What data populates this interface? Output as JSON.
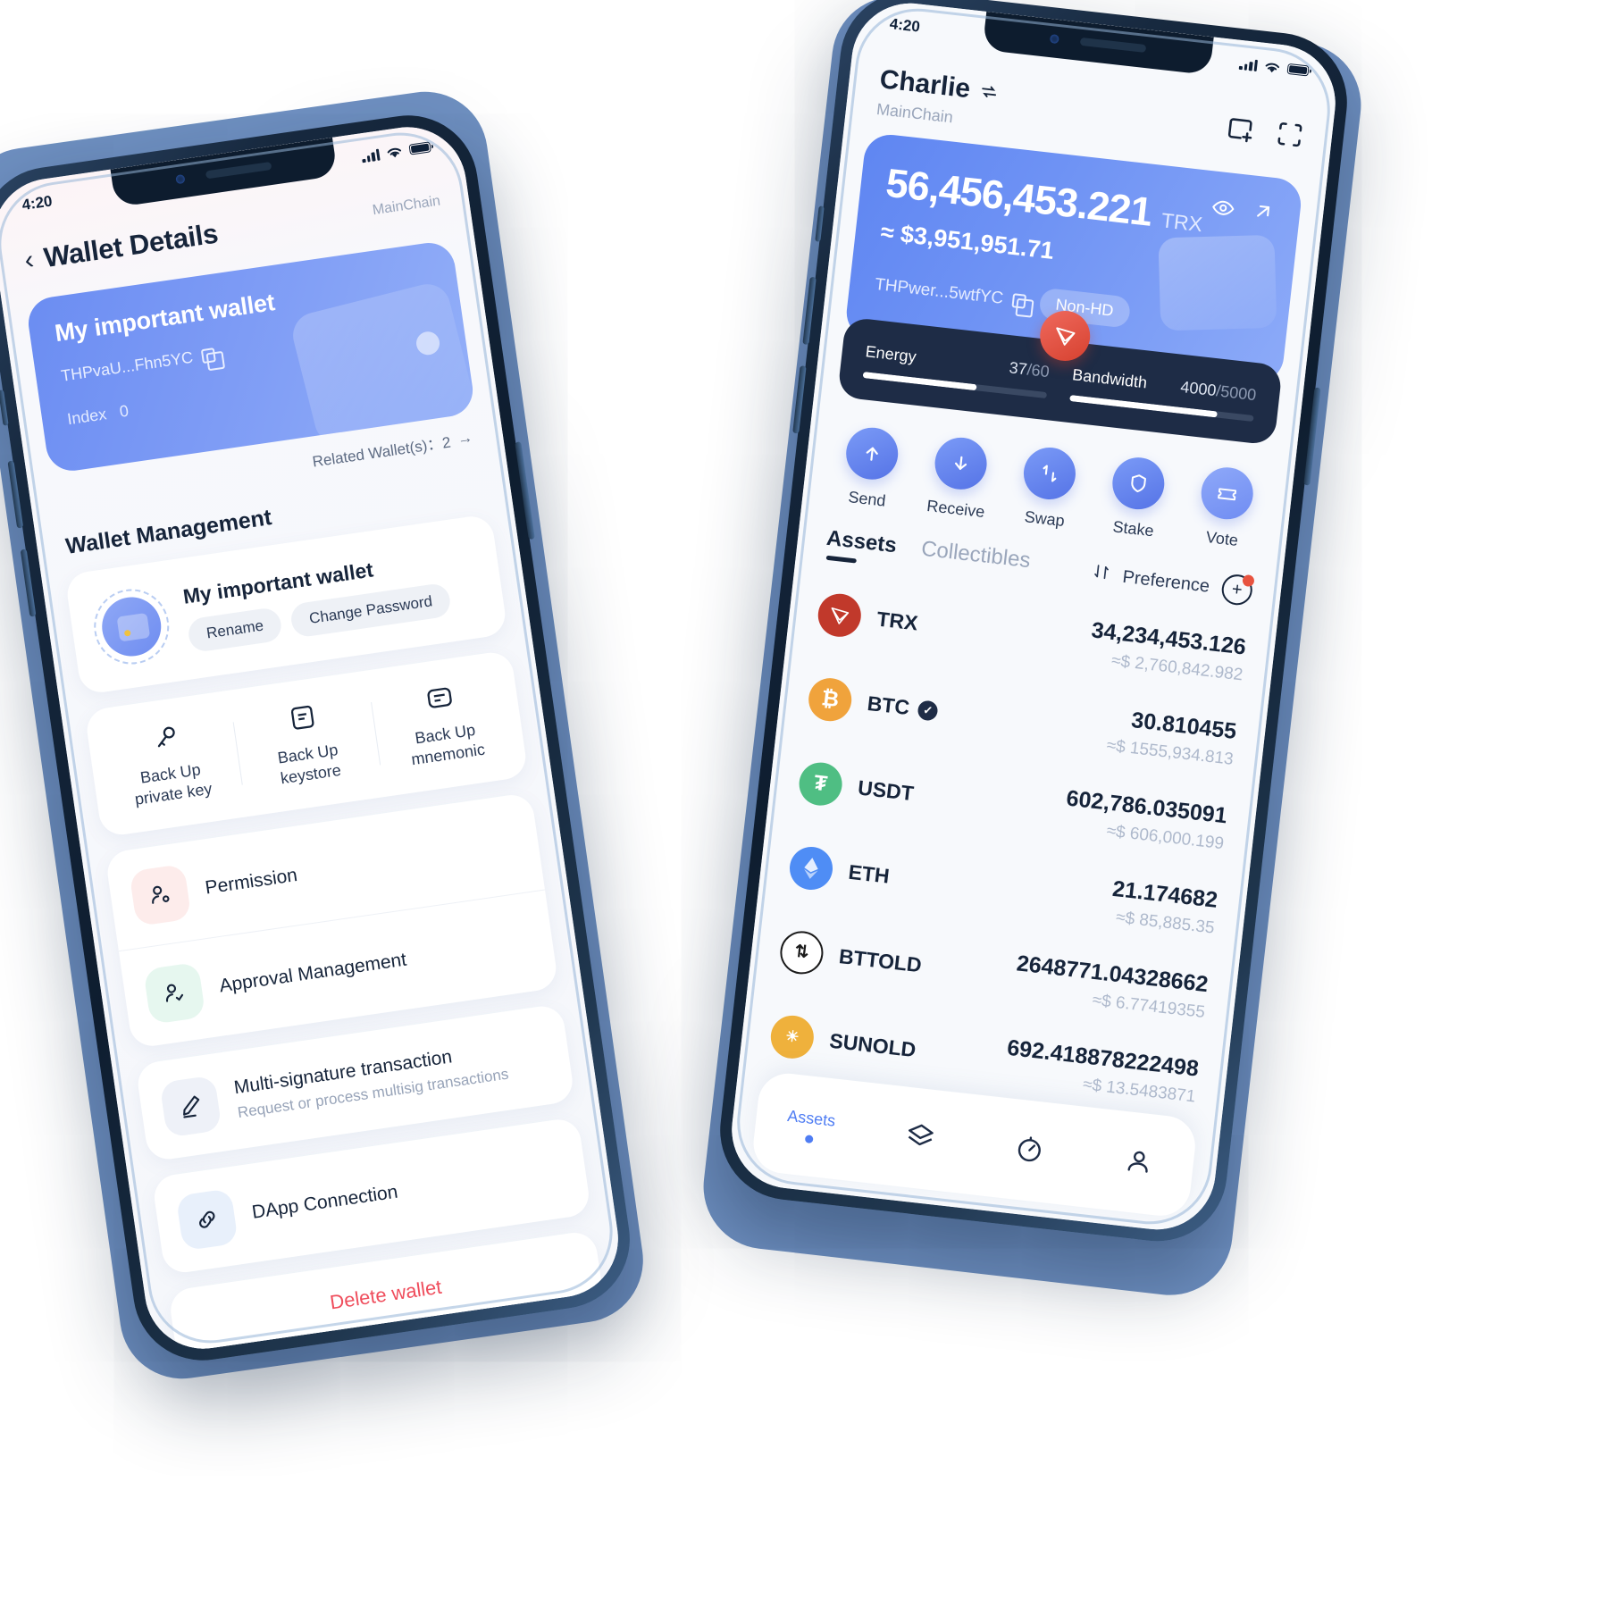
{
  "left_phone": {
    "status": {
      "time": "4:20"
    },
    "nav": {
      "back_icon": "chevron-left-icon",
      "title": "Wallet Details",
      "chain": "MainChain"
    },
    "wallet_card": {
      "name": "My important wallet",
      "address": "THPvaU...Fhn5YC",
      "copy_icon": "copy-icon",
      "index_label": "Index",
      "index_value": "0"
    },
    "related": {
      "label": "Related Wallet(s)：2",
      "arrow": "→"
    },
    "section_title": "Wallet Management",
    "wallet_row": {
      "name": "My important wallet",
      "buttons": [
        "Rename",
        "Change Password"
      ]
    },
    "backups": [
      {
        "icon": "key-icon",
        "label": "Back Up\nprivate key"
      },
      {
        "icon": "keystore-file-icon",
        "label": "Back Up\nkeystore"
      },
      {
        "icon": "mnemonic-list-icon",
        "label": "Back Up\nmnemonic"
      }
    ],
    "menu": [
      {
        "icon": "permission-user-icon",
        "label": "Permission",
        "sub": ""
      },
      {
        "icon": "approval-user-check-icon",
        "label": "Approval Management",
        "sub": ""
      },
      {
        "icon": "pencil-icon",
        "label": "Multi-signature transaction",
        "sub": "Request or process multisig transactions"
      },
      {
        "icon": "link-icon",
        "label": "DApp Connection",
        "sub": ""
      }
    ],
    "delete": {
      "label": "Delete wallet",
      "color": "#ef4d5c"
    }
  },
  "right_phone": {
    "status": {
      "time": "4:20"
    },
    "header": {
      "account_name": "Charlie",
      "switch_icon": "switch-account-icon",
      "chain": "MainChain",
      "icons": [
        "add-wallet-icon",
        "scan-qr-icon"
      ]
    },
    "balance": {
      "amount": "56,456,453.221",
      "unit": "TRX",
      "usd": "≈ $3,951,951.71",
      "address": "THPwer...5wtfYC",
      "copy_icon": "copy-icon",
      "tag": "Non-HD",
      "eye_icon": "eye-icon",
      "share_icon": "arrow-up-right-icon",
      "tron_badge_icon": "tron-logo-icon"
    },
    "resources": [
      {
        "label": "Energy",
        "value": "37",
        "max": "60",
        "percent": 62
      },
      {
        "label": "Bandwidth",
        "value": "4000",
        "max": "5000",
        "percent": 80
      }
    ],
    "actions": [
      {
        "icon": "arrow-up-icon",
        "label": "Send"
      },
      {
        "icon": "arrow-down-icon",
        "label": "Receive"
      },
      {
        "icon": "swap-icon",
        "label": "Swap"
      },
      {
        "icon": "shield-icon",
        "label": "Stake"
      },
      {
        "icon": "ticket-icon",
        "label": "Vote"
      }
    ],
    "tabs": [
      {
        "label": "Assets",
        "active": true
      },
      {
        "label": "Collectibles",
        "active": false
      }
    ],
    "preference": {
      "sort_icon": "sort-arrows-icon",
      "label": "Preference",
      "add_icon": "add-token-icon"
    },
    "assets": [
      {
        "symbol": "TRX",
        "icon": "tron-logo-icon",
        "color": "#c1392b",
        "verified": false,
        "amount": "34,234,453.126",
        "usd": "≈$ 2,760,842.982"
      },
      {
        "symbol": "BTC",
        "icon": "bitcoin-icon",
        "color": "#f0a33c",
        "verified": true,
        "amount": "30.810455",
        "usd": "≈$ 1555,934.813"
      },
      {
        "symbol": "USDT",
        "icon": "tether-icon",
        "color": "#4fbe83",
        "verified": false,
        "amount": "602,786.035091",
        "usd": "≈$ 606,000.199"
      },
      {
        "symbol": "ETH",
        "icon": "ethereum-icon",
        "color": "#4f8df5",
        "verified": false,
        "amount": "21.174682",
        "usd": "≈$ 85,885.35"
      },
      {
        "symbol": "BTTOLD",
        "icon": "bittorrent-icon",
        "color": "#1b1b1b",
        "verified": false,
        "amount": "2648771.04328662",
        "usd": "≈$ 6.77419355"
      },
      {
        "symbol": "SUNOLD",
        "icon": "sun-token-icon",
        "color": "#efb13c",
        "verified": false,
        "amount": "692.418878222498",
        "usd": "≈$ 13.5483871"
      }
    ],
    "tabbar": [
      {
        "icon": "assets-icon",
        "label": "Assets",
        "active": true
      },
      {
        "icon": "layers-icon",
        "label": "",
        "active": false
      },
      {
        "icon": "explore-icon",
        "label": "",
        "active": false
      },
      {
        "icon": "profile-icon",
        "label": "",
        "active": false
      }
    ]
  },
  "theme": {
    "accent_blue": "#4f7df3",
    "card_blue": "#6b8df2",
    "dark_navy": "#1e2c46",
    "danger_red": "#ef4d5c",
    "muted": "#9aa6bb"
  }
}
